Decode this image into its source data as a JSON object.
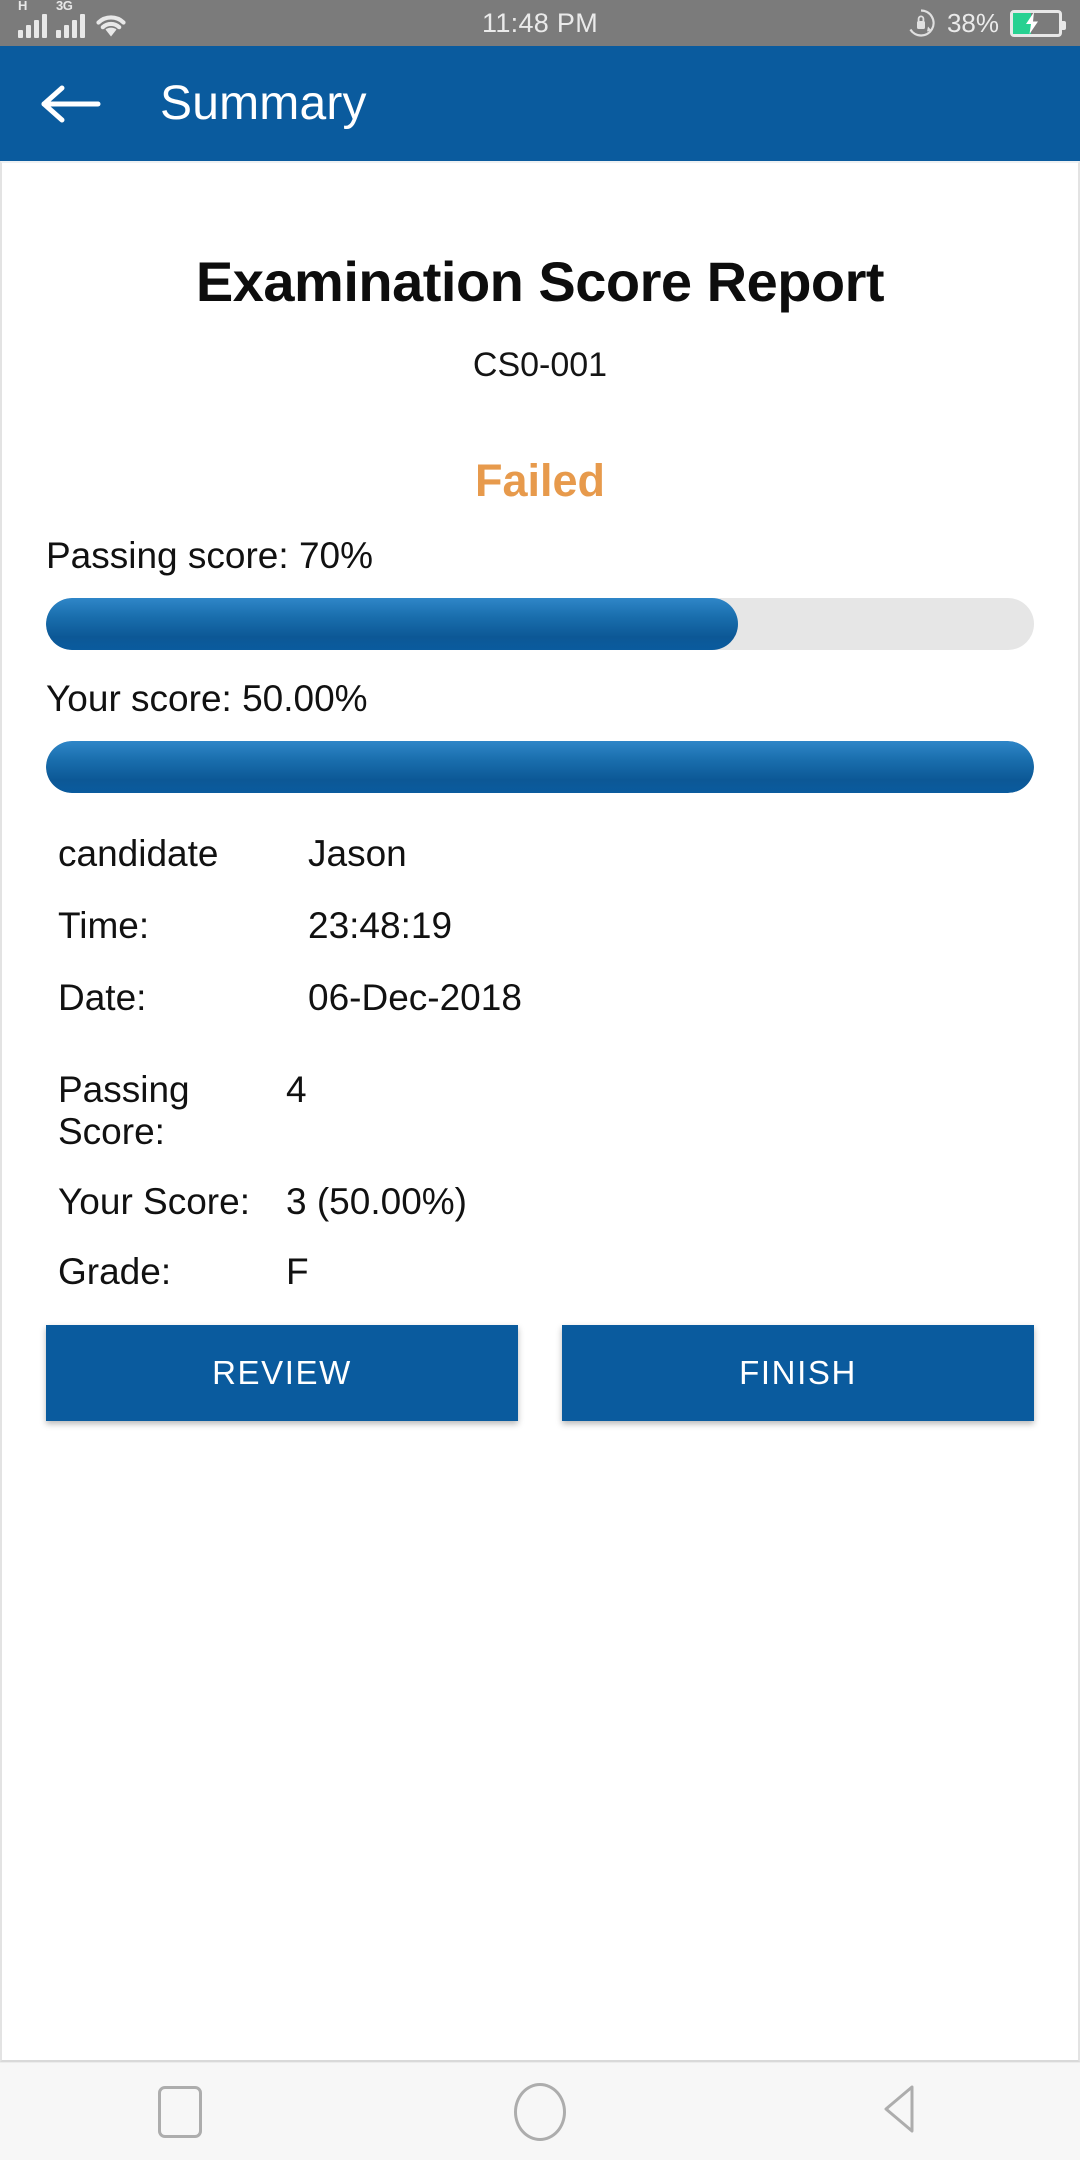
{
  "status_bar": {
    "signal_1_label": "H",
    "signal_2_label": "3G",
    "time": "11:48 PM",
    "battery_percent": "38%",
    "icons": {
      "signal": "signal-bars-icon",
      "wifi": "wifi-icon",
      "rotation_lock": "rotation-lock-icon",
      "battery": "battery-charging-icon"
    }
  },
  "appbar": {
    "back_icon": "back-arrow-icon",
    "title": "Summary",
    "background_color": "#0a5b9e"
  },
  "report": {
    "title": "Examination Score Report",
    "subtitle": "CS0-001",
    "verdict": "Failed",
    "verdict_color": "#e79a4c",
    "passing_score_label": "Passing score: 70%",
    "passing_score_percent": 70,
    "your_score_label": "Your score: 50.00%",
    "your_score_bar_percent": 100
  },
  "details": [
    {
      "key": "candidate",
      "value": "Jason"
    },
    {
      "key": "Time:",
      "value": "23:48:19"
    },
    {
      "key": "Date:",
      "value": "06-Dec-2018"
    }
  ],
  "scores": [
    {
      "key": "Passing Score:",
      "value": "4"
    },
    {
      "key": "Your Score:",
      "value": "3 (50.00%)"
    },
    {
      "key": "Grade:",
      "value": "F"
    }
  ],
  "buttons": {
    "review": "REVIEW",
    "finish": "FINISH",
    "color": "#0a5b9e"
  },
  "navbar": {
    "recents": "recents-square-icon",
    "home": "home-circle-icon",
    "back": "back-triangle-icon"
  }
}
